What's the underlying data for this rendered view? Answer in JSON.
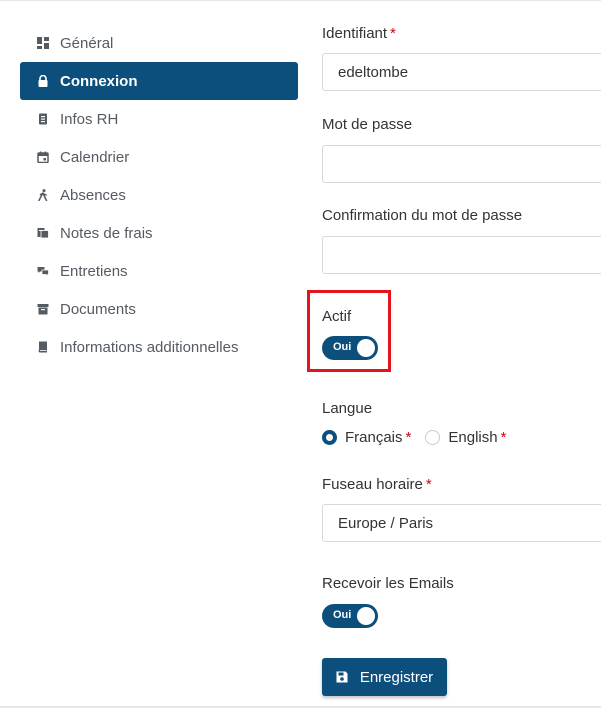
{
  "sidebar": {
    "items": [
      {
        "label": "Général",
        "icon": "dashboard-icon",
        "active": false
      },
      {
        "label": "Connexion",
        "icon": "lock-icon",
        "active": true
      },
      {
        "label": "Infos RH",
        "icon": "badge-icon",
        "active": false
      },
      {
        "label": "Calendrier",
        "icon": "calendar-icon",
        "active": false
      },
      {
        "label": "Absences",
        "icon": "walking-person-icon",
        "active": false
      },
      {
        "label": "Notes de frais",
        "icon": "receipt-icon",
        "active": false
      },
      {
        "label": "Entretiens",
        "icon": "chat-bubbles-icon",
        "active": false
      },
      {
        "label": "Documents",
        "icon": "archive-box-icon",
        "active": false
      },
      {
        "label": "Informations additionnelles",
        "icon": "book-icon",
        "active": false
      }
    ]
  },
  "form": {
    "identifiant": {
      "label": "Identifiant",
      "required_mark": "*",
      "value": "edeltombe"
    },
    "password": {
      "label": "Mot de passe",
      "value": ""
    },
    "password_confirm": {
      "label": "Confirmation du mot de passe",
      "value": ""
    },
    "actif": {
      "label": "Actif",
      "toggle_text": "Oui",
      "on": true
    },
    "langue": {
      "label": "Langue",
      "options": [
        {
          "label": "Français",
          "required_mark": "*",
          "selected": true
        },
        {
          "label": "English",
          "required_mark": "*",
          "selected": false
        }
      ]
    },
    "timezone": {
      "label": "Fuseau horaire",
      "required_mark": "*",
      "value": "Europe / Paris"
    },
    "emails": {
      "label": "Recevoir les Emails",
      "toggle_text": "Oui",
      "on": true
    },
    "save_label": "Enregistrer"
  },
  "colors": {
    "primary": "#0d4f7c",
    "required": "#d0021b",
    "highlight_box": "#e3141b",
    "nav_text": "#555b62"
  }
}
